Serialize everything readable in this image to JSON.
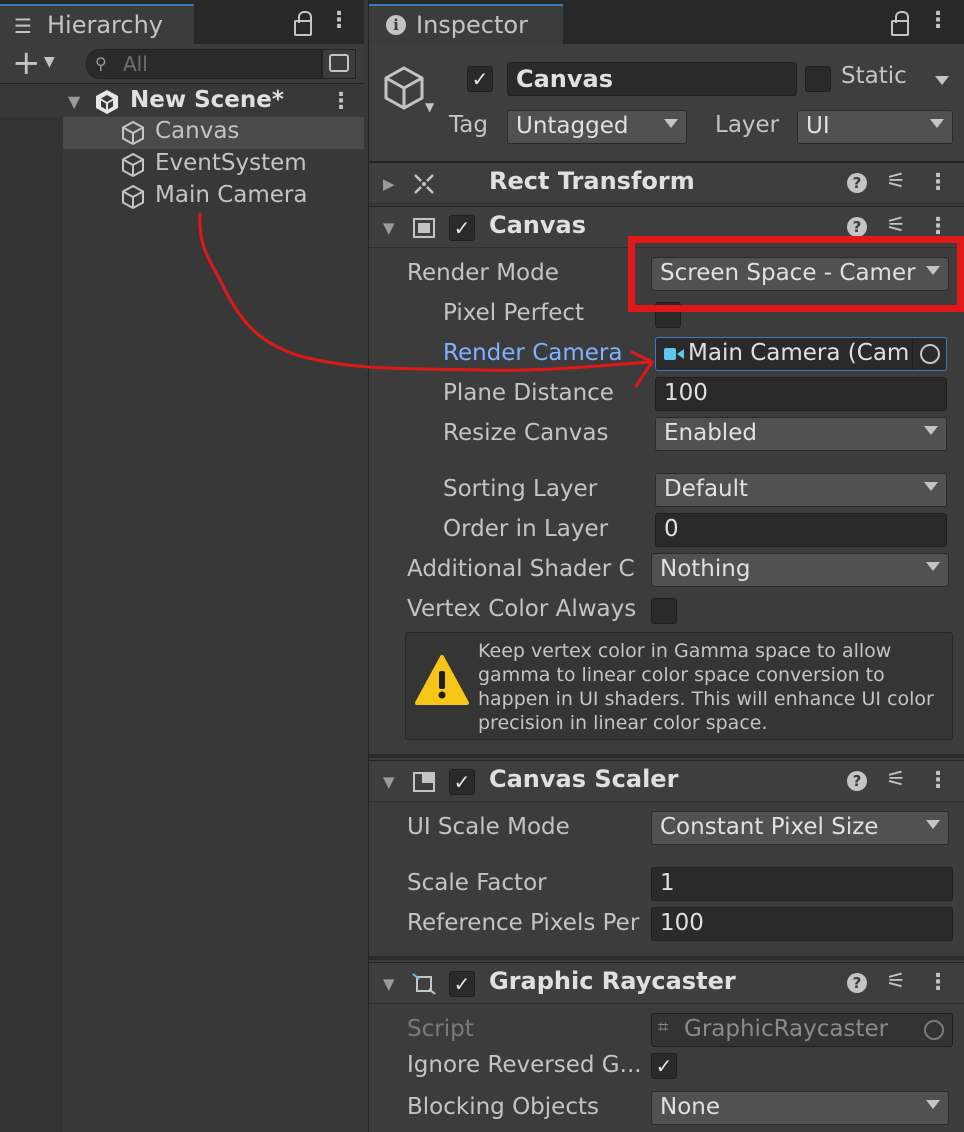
{
  "hierarchy": {
    "tab_title": "Hierarchy",
    "search_placeholder": "All",
    "scene_name": "New Scene*",
    "items": [
      {
        "label": "Canvas",
        "selected": true
      },
      {
        "label": "EventSystem",
        "selected": false
      },
      {
        "label": "Main Camera",
        "selected": false
      }
    ]
  },
  "inspector": {
    "tab_title": "Inspector",
    "object_name": "Canvas",
    "static_label": "Static",
    "tag_label": "Tag",
    "tag_value": "Untagged",
    "layer_label": "Layer",
    "layer_value": "UI",
    "rect_transform": {
      "title": "Rect Transform"
    },
    "canvas": {
      "title": "Canvas",
      "render_mode_label": "Render Mode",
      "render_mode_value": "Screen Space - Camer",
      "pixel_perfect_label": "Pixel Perfect",
      "render_camera_label": "Render Camera",
      "render_camera_value": "Main Camera (Cam",
      "plane_distance_label": "Plane Distance",
      "plane_distance_value": "100",
      "resize_canvas_label": "Resize Canvas",
      "resize_canvas_value": "Enabled",
      "sorting_layer_label": "Sorting Layer",
      "sorting_layer_value": "Default",
      "order_in_layer_label": "Order in Layer",
      "order_in_layer_value": "0",
      "additional_shader_label": "Additional Shader C",
      "additional_shader_value": "Nothing",
      "vertex_color_label": "Vertex Color Always",
      "warning_text": "Keep vertex color in Gamma space to allow gamma to linear color space conversion to happen in UI shaders. This will enhance UI color precision in linear color space."
    },
    "canvas_scaler": {
      "title": "Canvas Scaler",
      "ui_scale_mode_label": "UI Scale Mode",
      "ui_scale_mode_value": "Constant Pixel Size",
      "scale_factor_label": "Scale Factor",
      "scale_factor_value": "1",
      "reference_pixels_label": "Reference Pixels Per",
      "reference_pixels_value": "100"
    },
    "graphic_raycaster": {
      "title": "Graphic Raycaster",
      "script_label": "Script",
      "script_value": "GraphicRaycaster",
      "ignore_reversed_label": "Ignore Reversed G...",
      "blocking_objects_label": "Blocking Objects",
      "blocking_objects_value": "None"
    }
  },
  "colors": {
    "annotation_red": "#e01818",
    "link_blue": "#7fb2ff",
    "tab_accent": "#3a79bb",
    "camera_icon": "#5fc6f0",
    "warning_yellow": "#f5c518"
  },
  "icons": [
    "list-icon",
    "lock-icon",
    "kebab-icon",
    "plus-icon",
    "search-icon",
    "cube-icon",
    "unity-icon",
    "info-icon",
    "move-icon",
    "help-icon",
    "preset-icon",
    "camera-icon",
    "object-picker-icon",
    "warning-icon",
    "checkmark-icon"
  ]
}
